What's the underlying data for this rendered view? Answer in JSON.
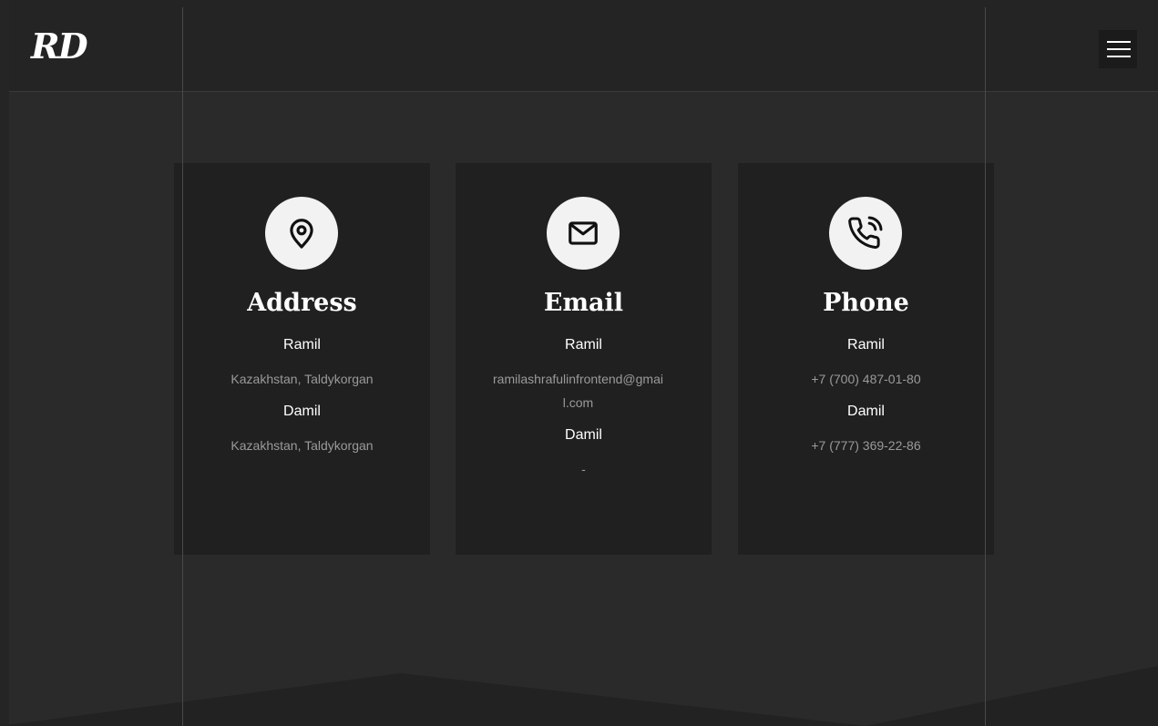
{
  "header": {
    "logo": "RD",
    "menu_icon": "hamburger-menu-icon"
  },
  "cards": [
    {
      "icon": "map-pin-icon",
      "title": "Address",
      "entries": [
        {
          "name": "Ramil",
          "value": "Kazakhstan, Taldykorgan"
        },
        {
          "name": "Damil",
          "value": "Kazakhstan, Taldykorgan"
        }
      ]
    },
    {
      "icon": "envelope-icon",
      "title": "Email",
      "entries": [
        {
          "name": "Ramil",
          "value": "ramilashrafulinfrontend@gmail.com"
        },
        {
          "name": "Damil",
          "value": "-"
        }
      ]
    },
    {
      "icon": "phone-icon",
      "title": "Phone",
      "entries": [
        {
          "name": "Ramil",
          "value": "+7 (700) 487-01-80"
        },
        {
          "name": "Damil",
          "value": "+7 (777) 369-22-86"
        }
      ]
    }
  ],
  "colors": {
    "background": "#2a2a2a",
    "header": "#242424",
    "card": "#202020",
    "icon_circle": "#f2f2f2",
    "text": "#ffffff",
    "muted_text": "#9a9a9a"
  }
}
